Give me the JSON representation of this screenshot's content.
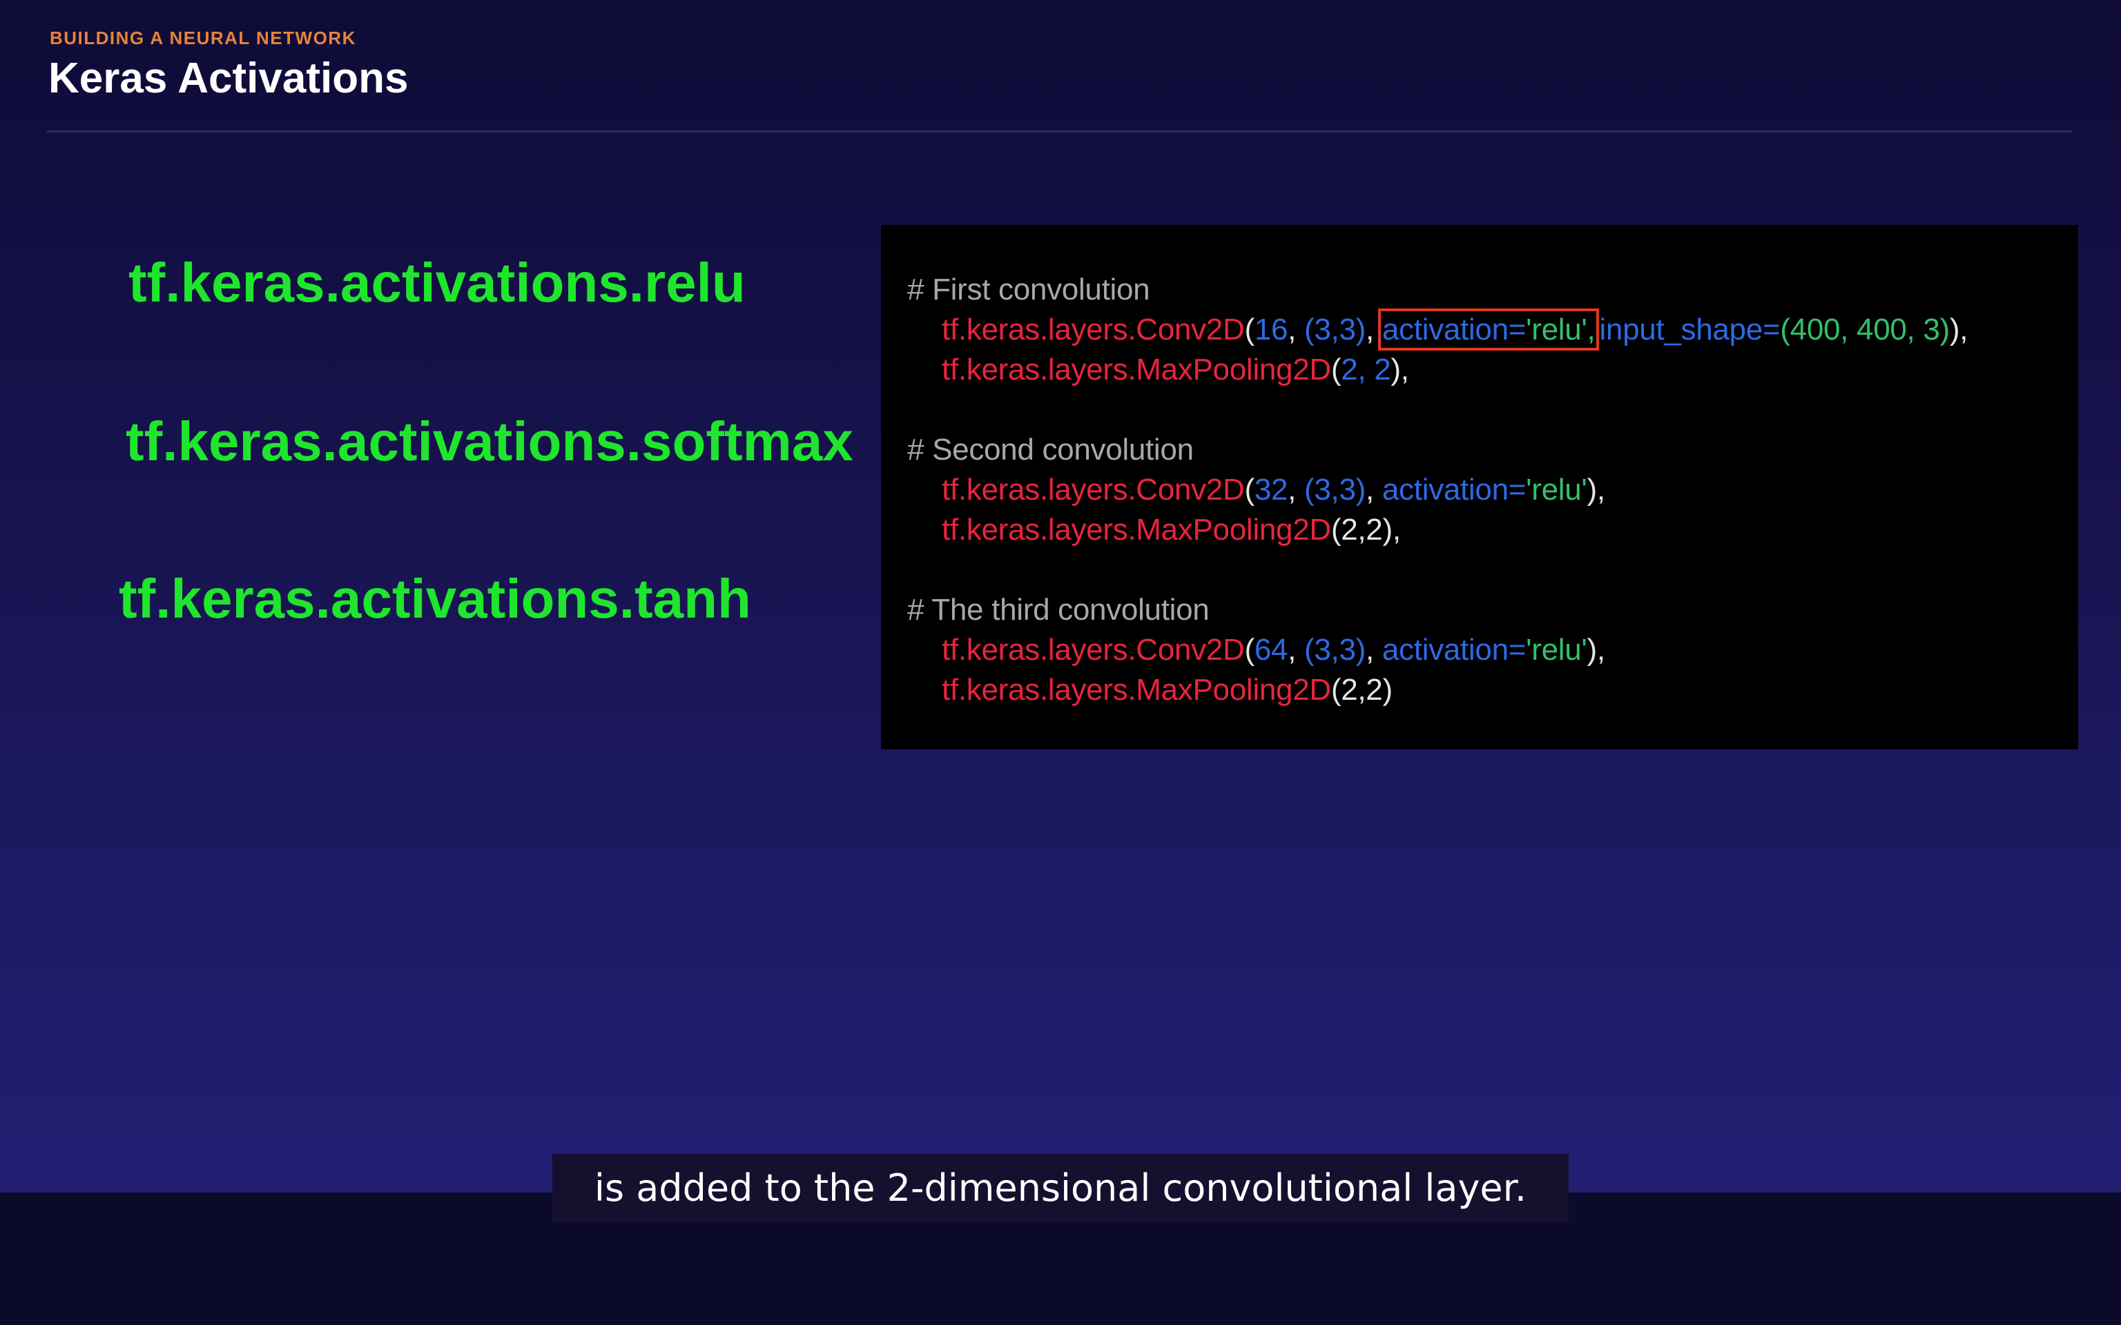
{
  "header": {
    "kicker": "BUILDING A NEURAL NETWORK",
    "title": "Keras Activations"
  },
  "activations": [
    "tf.keras.activations.relu",
    "tf.keras.activations.softmax",
    "tf.keras.activations.tanh"
  ],
  "code": {
    "block1": {
      "comment": "# First convolution",
      "conv_fn": "tf.keras.layers.Conv2D",
      "conv_open": "(",
      "conv_filters": "16",
      "comma1": ", ",
      "conv_kernel": "(3,3)",
      "comma2": ", ",
      "activation_kw": "activation=",
      "activation_val": "'relu',",
      "input_shape_kw": "input_shape=",
      "input_shape_val": "(400, 400, 3)",
      "conv_close": "),",
      "pool_fn": "tf.keras.layers.MaxPooling2D",
      "pool_open": "(",
      "pool_args": "2, 2",
      "pool_close": "),"
    },
    "block2": {
      "comment": "# Second convolution",
      "conv_fn": "tf.keras.layers.Conv2D",
      "conv_open": "(",
      "conv_filters": "32",
      "comma1": ", ",
      "conv_kernel": "(3,3)",
      "comma2": ", ",
      "activation_kw": "activation=",
      "activation_val": "'relu'",
      "conv_close": "),",
      "pool_fn": "tf.keras.layers.MaxPooling2D",
      "pool_args": "(2,2),"
    },
    "block3": {
      "comment": "# The third convolution",
      "conv_fn": "tf.keras.layers.Conv2D",
      "conv_open": "(",
      "conv_filters": "64",
      "comma1": ", ",
      "conv_kernel": "(3,3)",
      "comma2": ", ",
      "activation_kw": "activation=",
      "activation_val": "'relu'",
      "conv_close": "),",
      "pool_fn": "tf.keras.layers.MaxPooling2D",
      "pool_args": "(2,2)"
    }
  },
  "caption": "is added to the 2-dimensional convolutional layer.",
  "colors": {
    "accent_orange": "#e8833a",
    "activation_green": "#1fe62d",
    "code_function": "#e8243e",
    "code_number": "#2d6ae3",
    "code_string": "#33c06a",
    "highlight_box": "#e0391f"
  }
}
